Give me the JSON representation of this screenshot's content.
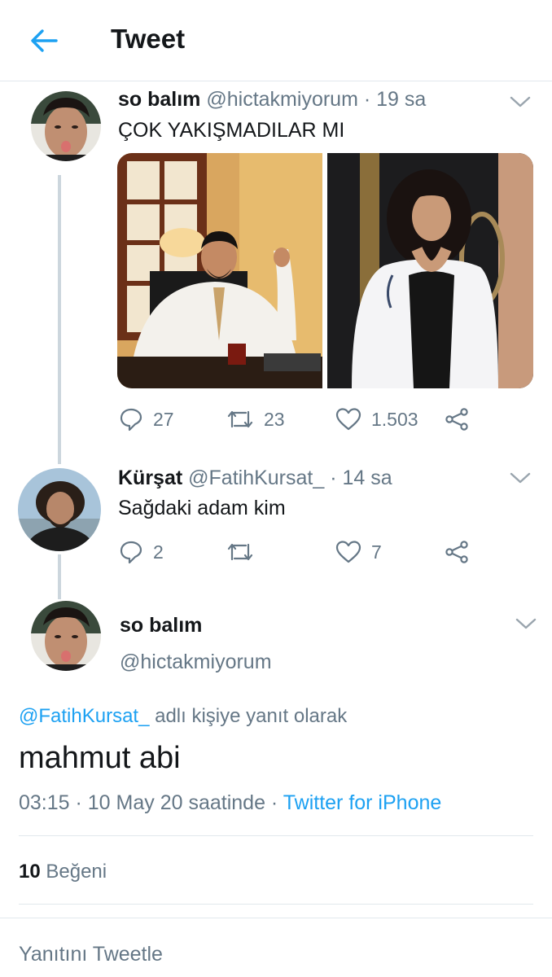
{
  "header": {
    "title": "Tweet",
    "back_icon": "arrow-left-icon",
    "accent": "#1da1f2"
  },
  "tweets": [
    {
      "name": "so balım",
      "handle": "@hictakmiyorum",
      "separator": "·",
      "time": "19 sa",
      "text": "ÇOK YAKIŞMADILAR MI",
      "replies": "27",
      "retweets": "23",
      "likes": "1.503"
    },
    {
      "name": "Kürşat",
      "handle": "@FatihKursat_",
      "separator": "·",
      "time": "14 sa",
      "text": "Sağdaki adam kim",
      "replies": "2",
      "retweets": "",
      "likes": "7"
    }
  ],
  "main_tweet": {
    "name": "so balım",
    "handle": "@hictakmiyorum",
    "reply_to_handle": "@FatihKursat_",
    "reply_to_suffix": "adlı kişiye yanıt olarak",
    "text": "mahmut abi",
    "timestamp": "03:15 · 10 May 20 saatinde · ",
    "source": "Twitter for iPhone",
    "likes_count": "10",
    "likes_label": "Beğeni"
  },
  "reply_prompt": "Yanıtını Tweetle",
  "colors": {
    "text": "#14171a",
    "muted": "#657786",
    "link": "#1da1f2",
    "border": "#e1e8ed"
  }
}
